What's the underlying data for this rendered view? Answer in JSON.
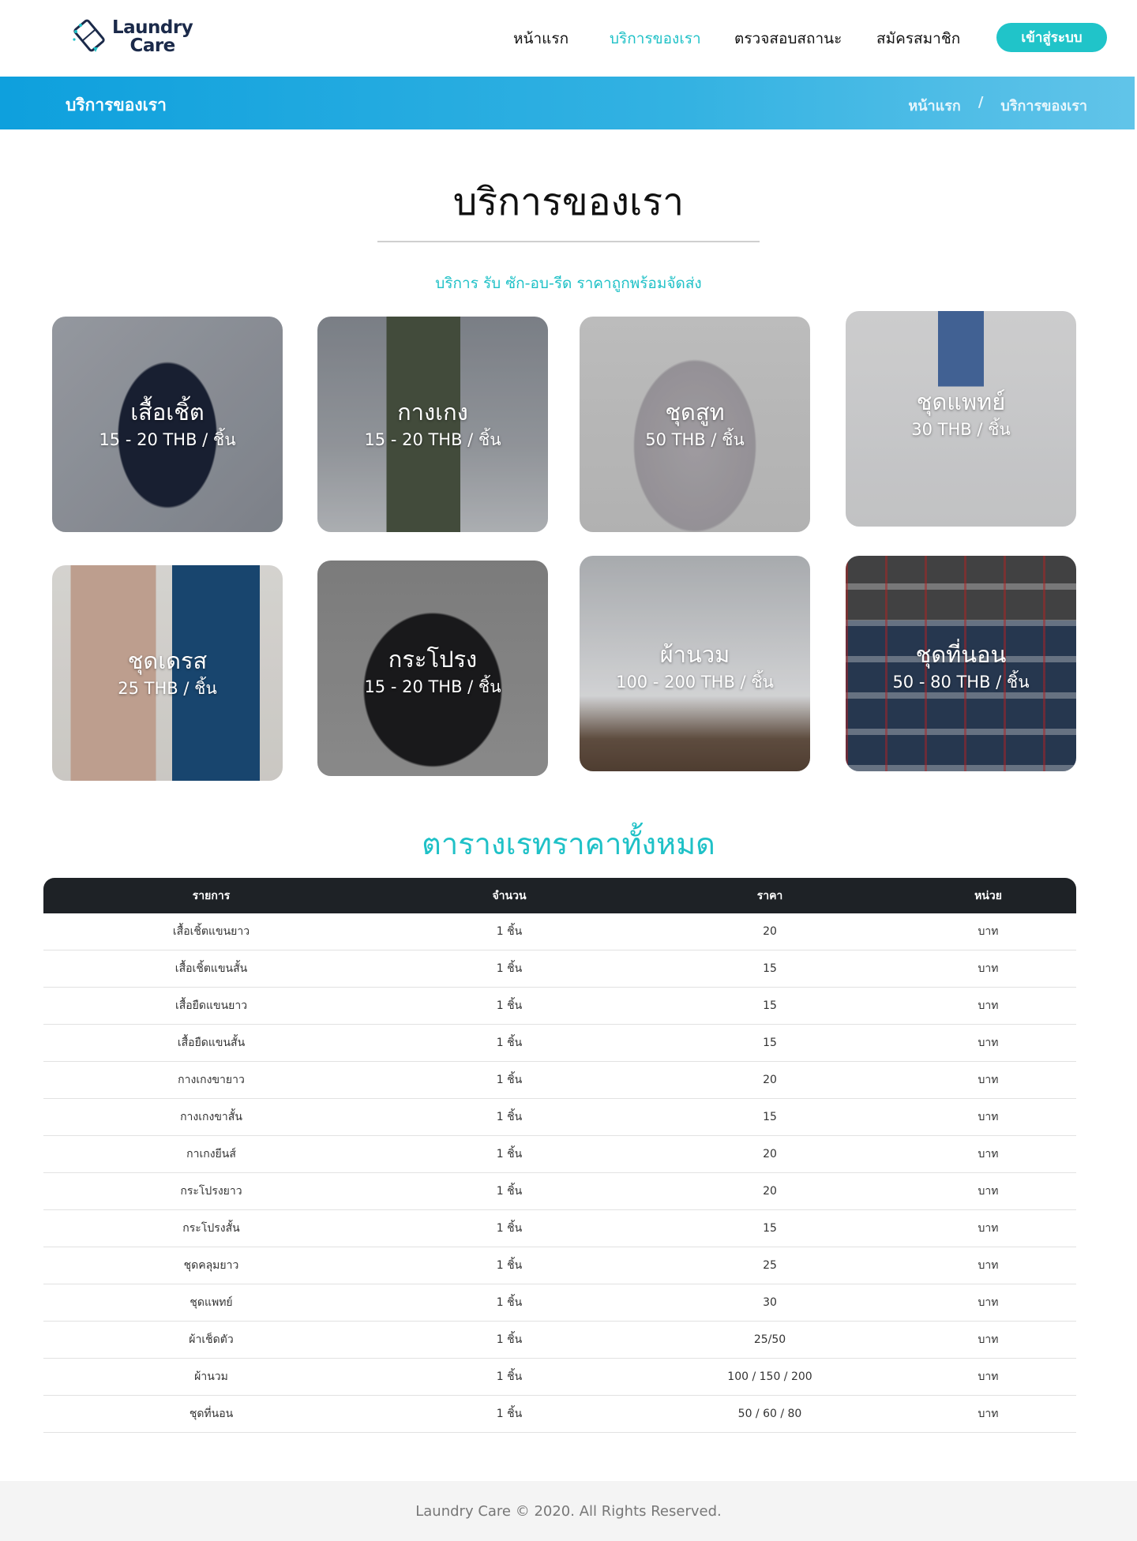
{
  "header": {
    "logo_line1": "Laundry",
    "logo_line2": "Care",
    "nav": [
      {
        "label": "หน้าแรก",
        "active": false
      },
      {
        "label": "บริการของเรา",
        "active": true
      },
      {
        "label": "ตรวจสอบสถานะ",
        "active": false
      },
      {
        "label": "สมัครสมาชิก",
        "active": false
      }
    ],
    "login_label": "เข้าสู่ระบบ"
  },
  "banner": {
    "title": "บริการของเรา",
    "breadcrumb_home": "หน้าแรก",
    "breadcrumb_sep": "/",
    "breadcrumb_current": "บริการของเรา"
  },
  "section": {
    "title": "บริการของเรา",
    "subtitle": "บริการ รับ ซัก-อบ-รีด ราคาถูกพร้อมจัดส่ง"
  },
  "cards": [
    {
      "name": "เสื้อเชิ้ต",
      "price": "15 - 20 THB / ชิ้น",
      "icon": "shirt-photo"
    },
    {
      "name": "กางเกง",
      "price": "15 - 20 THB / ชิ้น",
      "icon": "pants-photo"
    },
    {
      "name": "ชุดสูท",
      "price": "50 THB / ชิ้น",
      "icon": "suit-photo"
    },
    {
      "name": "ชุดแพทย์",
      "price": "30 THB / ชิ้น",
      "icon": "doctor-coat-photo"
    },
    {
      "name": "ชุดเดรส",
      "price": "25 THB / ชิ้น",
      "icon": "dress-photo"
    },
    {
      "name": "กระโปรง",
      "price": "15 - 20 THB / ชิ้น",
      "icon": "skirt-photo"
    },
    {
      "name": "ผ้านวม",
      "price": "100 - 200 THB / ชิ้น",
      "icon": "duvet-photo"
    },
    {
      "name": "ชุดที่นอน",
      "price": "50 - 80 THB / ชิ้น",
      "icon": "bedding-photo"
    }
  ],
  "price_table": {
    "title": "ตารางเรทราคาทั้งหมด",
    "headers": [
      "รายการ",
      "จำนวน",
      "ราคา",
      "หน่วย"
    ],
    "rows": [
      [
        "เสื้อเชิ้ตแขนยาว",
        "1 ชิ้น",
        "20",
        "บาท"
      ],
      [
        "เสื้อเชิ้ตแขนสั้น",
        "1 ชิ้น",
        "15",
        "บาท"
      ],
      [
        "เสื้อยืดแขนยาว",
        "1 ชิ้น",
        "15",
        "บาท"
      ],
      [
        "เสื้อยืดแขนสั้น",
        "1 ชิ้น",
        "15",
        "บาท"
      ],
      [
        "กางเกงขายาว",
        "1 ชิ้น",
        "20",
        "บาท"
      ],
      [
        "กางเกงขาสั้น",
        "1 ชิ้น",
        "15",
        "บาท"
      ],
      [
        "กาเกงยีนส์",
        "1 ชิ้น",
        "20",
        "บาท"
      ],
      [
        "กระโปรงยาว",
        "1 ชิ้น",
        "20",
        "บาท"
      ],
      [
        "กระโปรงสั้น",
        "1 ชิ้น",
        "15",
        "บาท"
      ],
      [
        "ชุดคลุมยาว",
        "1 ชิ้น",
        "25",
        "บาท"
      ],
      [
        "ชุดแพทย์",
        "1 ชิ้น",
        "30",
        "บาท"
      ],
      [
        "ผ้าเช็ดตัว",
        "1 ชิ้น",
        "25/50",
        "บาท"
      ],
      [
        "ผ้านวม",
        "1 ชิ้น",
        "100 / 150 / 200",
        "บาท"
      ],
      [
        "ชุดที่นอน",
        "1 ชิ้น",
        "50 / 60 / 80",
        "บาท"
      ]
    ]
  },
  "footer": {
    "text": "Laundry Care © 2020. All Rights Reserved."
  },
  "colors": {
    "accent": "#1fc1c7",
    "banner_start": "#0ea0dd",
    "banner_end": "#61c4e9",
    "table_header": "#1e2226",
    "logo_navy": "#1b2a4a"
  }
}
